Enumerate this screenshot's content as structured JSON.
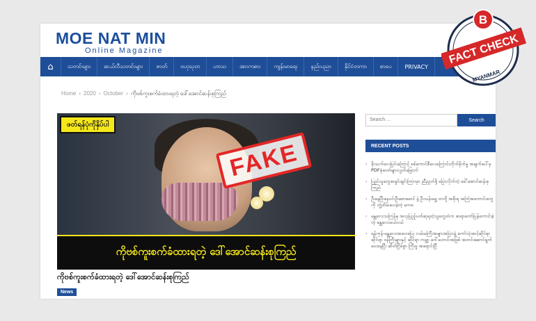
{
  "site": {
    "title": "MOE NAT MIN",
    "subtitle": "Online Magazine"
  },
  "nav": {
    "items": [
      "သတင်းများ",
      "ဆယ်လီသတင်းများ",
      "ဇာတ်",
      "ဗဟုသုတ",
      "ဟာသ",
      "အားကစား",
      "ကျန်းမာရေး",
      "နည်းပညာ",
      "နိုင်ငံတကာ",
      "စာပေ",
      "PRIVACY"
    ]
  },
  "breadcrumb": {
    "home": "Home",
    "year": "2020",
    "month": "October",
    "current": "ကိုဗစ်ကူးစက်ခံထားရတဲ့ ဒေါ်အောင်ဆန်းစုကြည်"
  },
  "hero": {
    "label": "ဖတ်ရန်ပုံကိုနှိပ်ပါ",
    "stamp": "FAKE",
    "caption": "ကိုဗစ်ကူးစက်ခံထားရတဲ့ ဒေါ်အောင်ဆန်းစုကြည်"
  },
  "article": {
    "title": "ကိုဗစ်ကူးစက်ခံထားရတဲ့ ဒေါ်အောင်ဆန်းစုကြည်",
    "category": "News"
  },
  "sidebar": {
    "search_placeholder": "Search ...",
    "search_button": "Search",
    "recent_title": "RECENT POSTS",
    "recent_posts": [
      "ခိုးသက်လေပြင်းကြောင့် စစ်ကောင်စီလေကြောင်းတိုက်ခိုက်မှု အချက်ပေါ်မှ PDFစုံတော်များလွတ်မြောက်",
      "ပြည်သူတွေအရှင်းချင်းကြားမှာ ညီညွတ်ဖို့ ပြောလိုက်တဲ့ ဒေါ်အောင်ဆန်းစုကြည်",
      "ဦးနေပြီးနေဝင်းဦးစောမောင် နဲ့ ဦးသန်းရွှေ တတို့ အစိုးရ အကြံအကောင်းတွေကို ဘွဲ့ထိမ်းပေးခဲ့တဲ့ ကေစ",
      "မန္တလေးသကြန်မှ အလှပြည့်ပတ်ဆုရတဲ့သူတွေထဲက ဆရာတော်ပြန်ကောင်းခဲ့တဲ့ မန္တလေးမယ်ပယ်",
      "ရန်ကုန်-မန္တလေးအဝေးပြေး လမ်းမကြီးအများအပြားနဲ့ ကော်သုံးဆင့်ဆိုင်ရာဆိုင်ရာ ဝန်ကြီးများနှင့် ဆိုင်ရာ ကမ္ဘာ့ ဂေါ်ဟောင်းအဖြစ် အတင်းဆောင်ရွက်ပေးနေပြီး ဆိတ်ငြိမ်စွာ ကြီးမှု အရောင်းပြီ"
    ]
  },
  "factcheck": {
    "letter": "B",
    "text": "FACT CHECK",
    "country": "MYANMAR",
    "colors": {
      "red": "#d62828",
      "navy": "#1c2b4a"
    }
  }
}
